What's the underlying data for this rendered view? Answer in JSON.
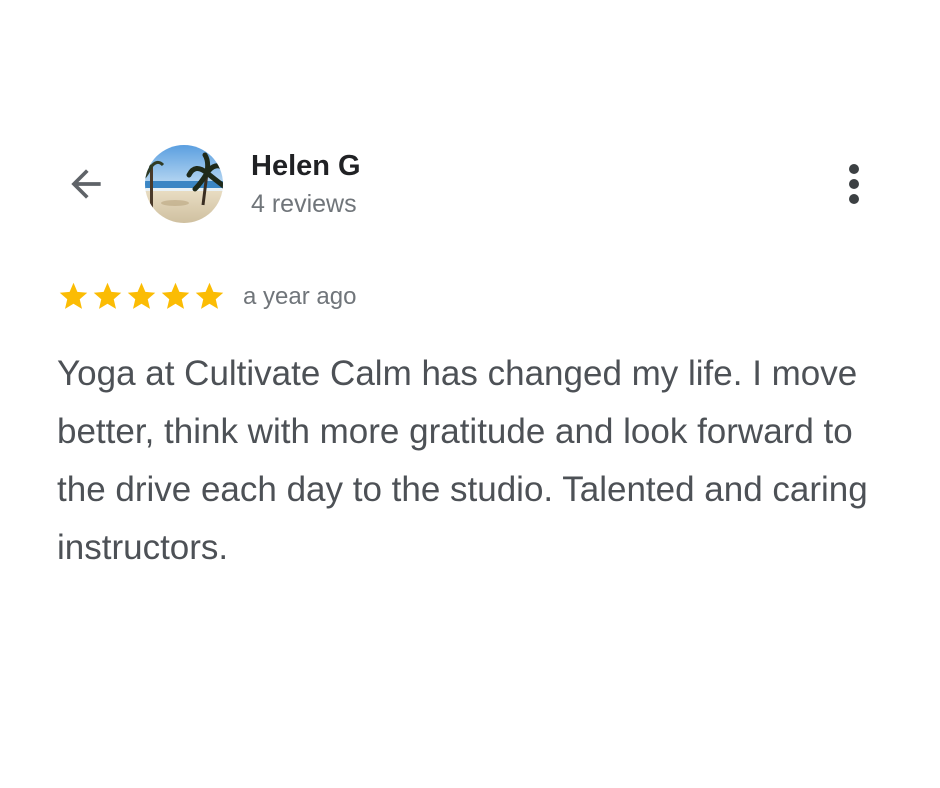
{
  "review": {
    "author": {
      "name": "Helen G",
      "review_count": "4 reviews",
      "avatar": "beach-photo-avatar"
    },
    "rating": {
      "value": 5,
      "max": 5,
      "color": "#fbbc04"
    },
    "time": "a year ago",
    "text": "Yoga at Cultivate Calm has changed my life. I move better, think with more gratitude and look forward to the drive each day to the studio. Talented and caring instructors."
  },
  "icons": {
    "back": "arrow-left-icon",
    "more": "more-vertical-icon",
    "star": "star-icon"
  },
  "colors": {
    "name": "#202124",
    "secondary": "#70757a",
    "body": "#4d5156",
    "star": "#fbbc04",
    "icon": "#5f6368"
  }
}
